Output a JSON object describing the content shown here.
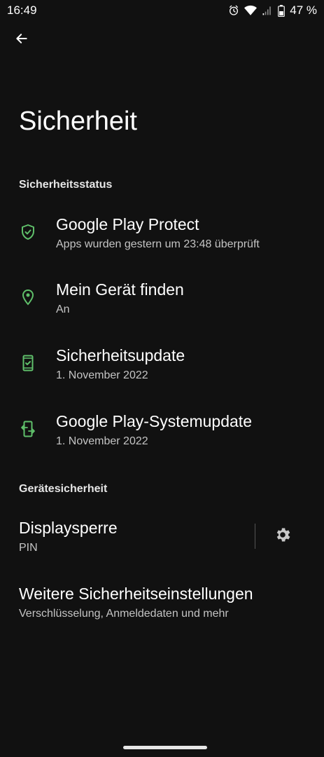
{
  "status_bar": {
    "time": "16:49",
    "battery": "47 %",
    "icons": [
      "alarm-icon",
      "wifi-icon",
      "signal-icon",
      "battery-icon"
    ]
  },
  "header": {
    "back_icon": "arrow-left-icon",
    "title": "Sicherheit"
  },
  "sections": {
    "security_status": {
      "label": "Sicherheitsstatus",
      "items": [
        {
          "icon": "shield-check-icon",
          "title": "Google Play Protect",
          "subtitle": "Apps wurden gestern um 23:48 überprüft"
        },
        {
          "icon": "location-pin-icon",
          "title": "Mein Gerät finden",
          "subtitle": "An"
        },
        {
          "icon": "phone-check-icon",
          "title": "Sicherheitsupdate",
          "subtitle": "1. November 2022"
        },
        {
          "icon": "phone-update-icon",
          "title": "Google Play-Systemupdate",
          "subtitle": "1. November 2022"
        }
      ]
    },
    "device_security": {
      "label": "Gerätesicherheit",
      "items": [
        {
          "title": "Displaysperre",
          "subtitle": "PIN",
          "action_icon": "gear-icon"
        },
        {
          "title": "Weitere Sicherheitseinstellungen",
          "subtitle": "Verschlüsselung, Anmeldedaten und mehr"
        }
      ]
    }
  },
  "colors": {
    "background": "#111111",
    "accent_icon": "#5fbf6a",
    "text_primary": "#ffffff",
    "text_secondary": "#c4c4c4"
  }
}
